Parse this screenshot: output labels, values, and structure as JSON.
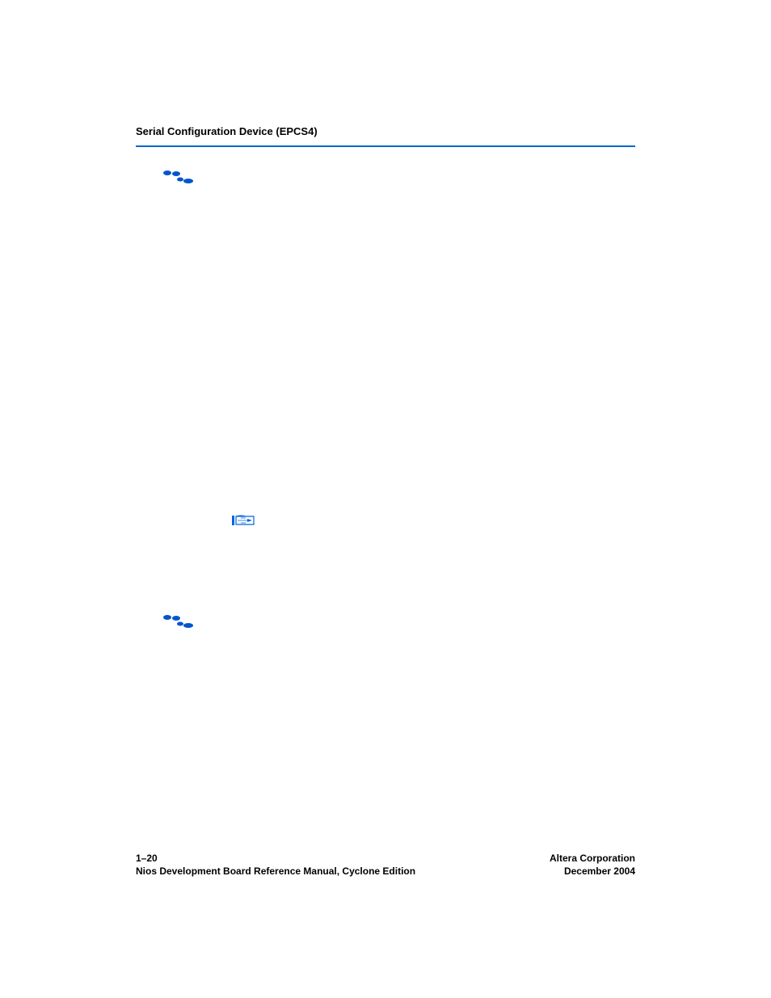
{
  "header": {
    "title": "Serial Configuration Device (EPCS4)"
  },
  "footer": {
    "left_line1": "1–20",
    "left_line2": "Nios Development Board Reference Manual, Cyclone Edition",
    "right_line1": "Altera Corporation",
    "right_line2": "December 2004"
  },
  "icons": {
    "steps1": "steps-icon",
    "pointer": "pointer-icon",
    "steps2": "steps-icon"
  }
}
